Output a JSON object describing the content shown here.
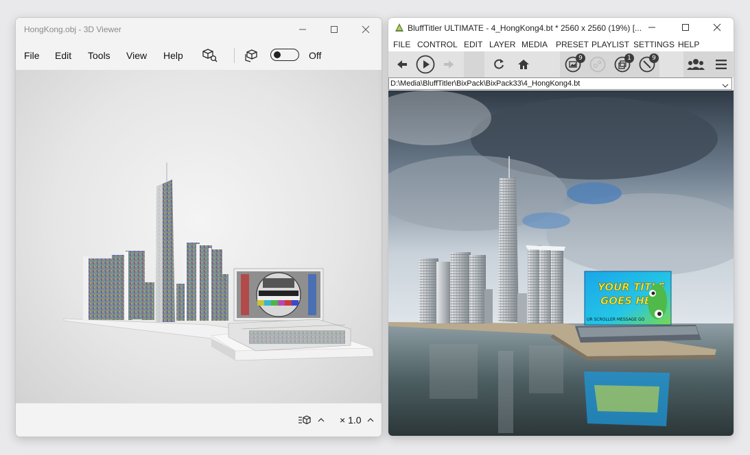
{
  "viewer": {
    "title": "HongKong.obj - 3D Viewer",
    "menu": [
      "File",
      "Edit",
      "Tools",
      "View",
      "Help"
    ],
    "toggle_label": "Off",
    "zoom_label": "× 1.0",
    "icons": {
      "minimize": "minimize-icon",
      "maximize": "maximize-icon",
      "close": "close-icon",
      "inspect": "cube-search-icon",
      "mixed_reality": "cube-view-icon",
      "grid": "grid-cube-icon",
      "chevron": "chevron-up-icon"
    }
  },
  "blufftitler": {
    "title": "BluffTitler ULTIMATE  - 4_HongKong4.bt * 2560 x 2560 (19%) [...",
    "menu": [
      "FILE",
      "CONTROL",
      "EDIT",
      "LAYER",
      "MEDIA",
      "PRESET",
      "PLAYLIST",
      "SETTINGS",
      "HELP"
    ],
    "path": "D:\\Media\\BluffTitler\\BixPack\\BixPack33\\4_HongKong4.bt",
    "badges": {
      "media": "9",
      "layers": "1",
      "effects": "9"
    },
    "billboard_title_line1": "YOUR TITLE",
    "billboard_title_line2": "GOES HERE",
    "scroller": "UR SCROLLER MESSAGE GO",
    "icons": {
      "back": "arrow-left-icon",
      "play": "play-icon",
      "forward": "arrow-right-icon",
      "reload": "reload-icon",
      "home": "home-icon",
      "media": "image-icon",
      "camera": "camera-icon",
      "layers": "layers-icon",
      "effects": "wand-icon",
      "users": "users-icon",
      "menu": "hamburger-menu-icon",
      "dropdown": "chevron-down-icon"
    }
  }
}
